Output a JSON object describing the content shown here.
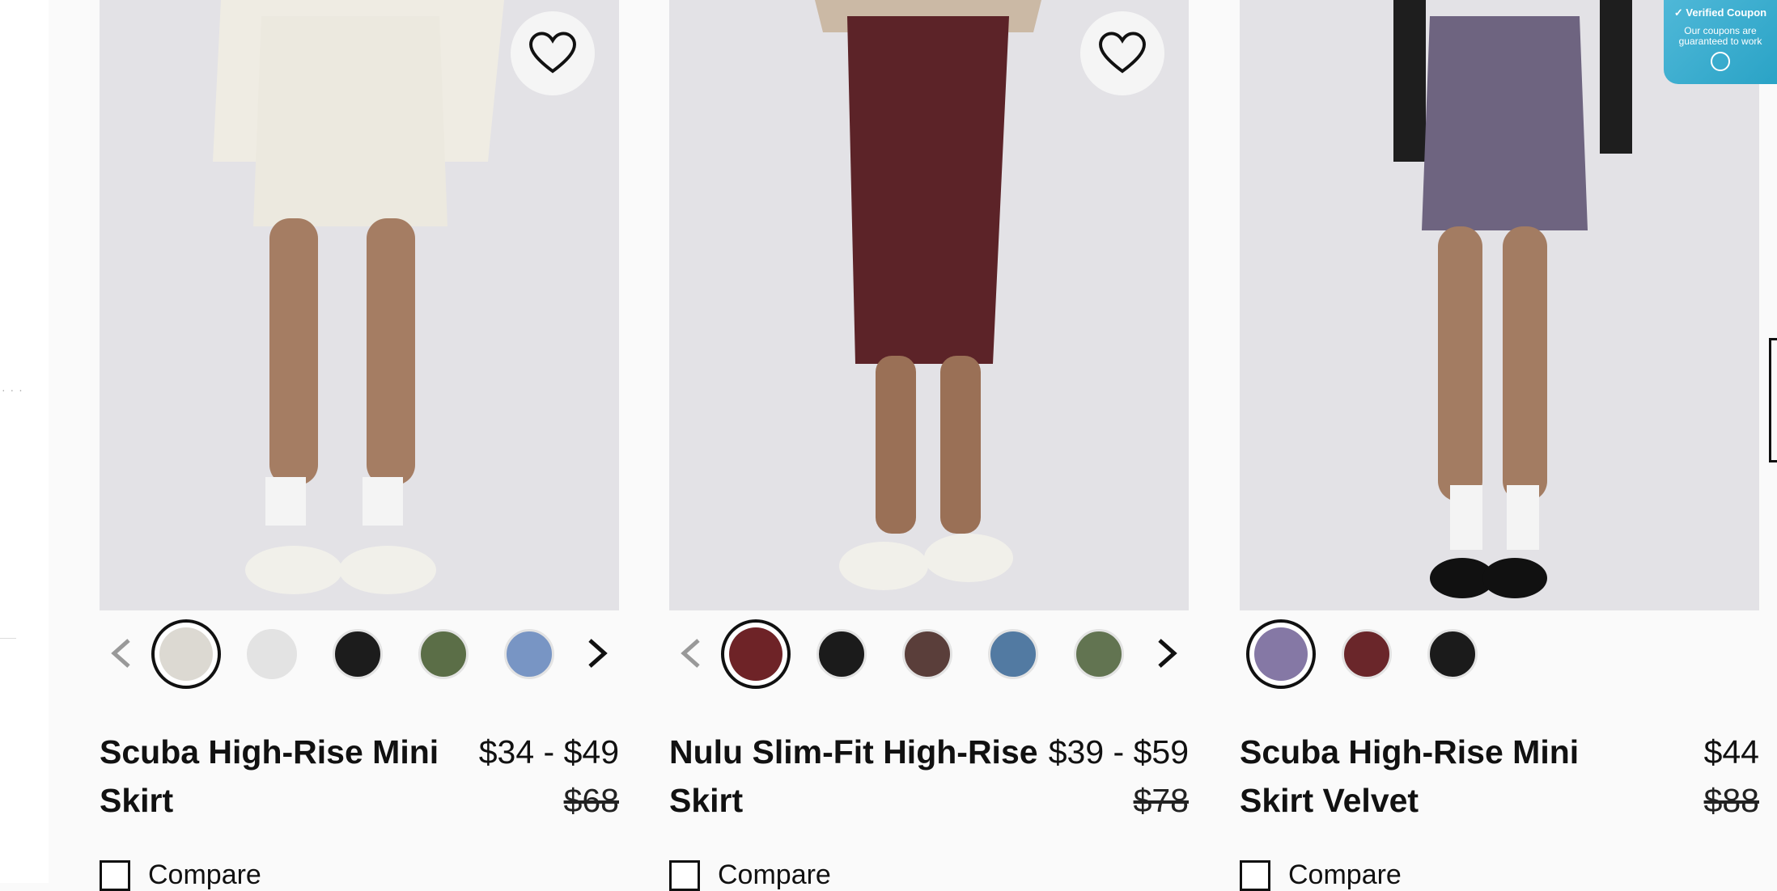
{
  "products": [
    {
      "name": "Scuba High-Rise Mini Skirt",
      "price": "$34 - $49",
      "original_price": "$68",
      "compare_label": "Compare",
      "image_bg": "#e4e3e7",
      "swatches": [
        "#dcd9d2",
        "#e3e3e3",
        "#1c1c1c",
        "#5b6e47",
        "#7895c4"
      ]
    },
    {
      "name": "Nulu Slim-Fit High-Rise Skirt",
      "price": "$39 - $59",
      "original_price": "$78",
      "compare_label": "Compare",
      "image_bg": "#e4e3e7",
      "swatches": [
        "#6e2327",
        "#1b1b1b",
        "#5a3e3a",
        "#527aa2",
        "#627451"
      ]
    },
    {
      "name": "Scuba High-Rise Mini Skirt Velvet",
      "price": "$44",
      "original_price": "$88",
      "compare_label": "Compare",
      "image_bg": "#e4e3e7",
      "swatches": [
        "#8578a5",
        "#6a262a",
        "#1b1b1b"
      ]
    }
  ],
  "coupon": {
    "title": "Verified Coupon",
    "subtitle": "Our coupons are guaranteed to work",
    "color": "#3ab0d2"
  },
  "icons": {
    "favorite": "heart-outline-icon",
    "prev": "chevron-left-icon",
    "next": "chevron-right-icon"
  }
}
